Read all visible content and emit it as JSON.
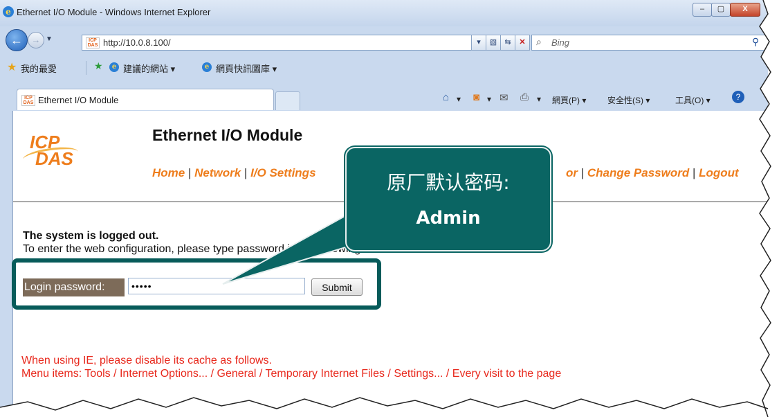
{
  "window": {
    "title": "Ethernet I/O Module - Windows Internet Explorer",
    "min_glyph": "‒",
    "max_glyph": "▢",
    "close_glyph": "X"
  },
  "navbar": {
    "address": "http://10.0.8.100/",
    "search_placeholder": "Bing",
    "back_glyph": "←",
    "forward_glyph": "→"
  },
  "favorites_bar": {
    "favorites_label": "我的最愛",
    "suggested_sites": "建議的網站 ▾",
    "web_slice_gallery": "網頁快訊圖庫 ▾"
  },
  "tab": {
    "title": "Ethernet I/O Module"
  },
  "command_bar": {
    "page_label": "網頁(P) ▾",
    "safety_label": "安全性(S) ▾",
    "tools_label": "工具(O) ▾"
  },
  "page": {
    "title": "Ethernet I/O Module",
    "menu": {
      "home": "Home",
      "network": "Network",
      "io_settings": "I/O Settings",
      "monitor_partial": "or",
      "change_password": "Change Password",
      "logout": "Logout"
    },
    "logout_message": "The system is logged out.",
    "instruction": "To enter the web configuration, please type password in the following field.",
    "login_label": "Login password:",
    "password_value": "admin",
    "submit_label": "Submit",
    "warning_line1": "When using IE, please disable its cache as follows.",
    "warning_line2": "Menu items: Tools / Internet Options... / General / Temporary Internet Files / Settings... / Every visit to the page"
  },
  "callout": {
    "line1": "原厂默认密码:",
    "line2": "Admin"
  },
  "logo": {
    "top": "ICP",
    "bottom": "DAS"
  },
  "colors": {
    "accent_orange": "#ee7d1c",
    "callout_teal": "#0a6563",
    "warning_red": "#e8281c",
    "label_brown": "#7d6b59"
  }
}
